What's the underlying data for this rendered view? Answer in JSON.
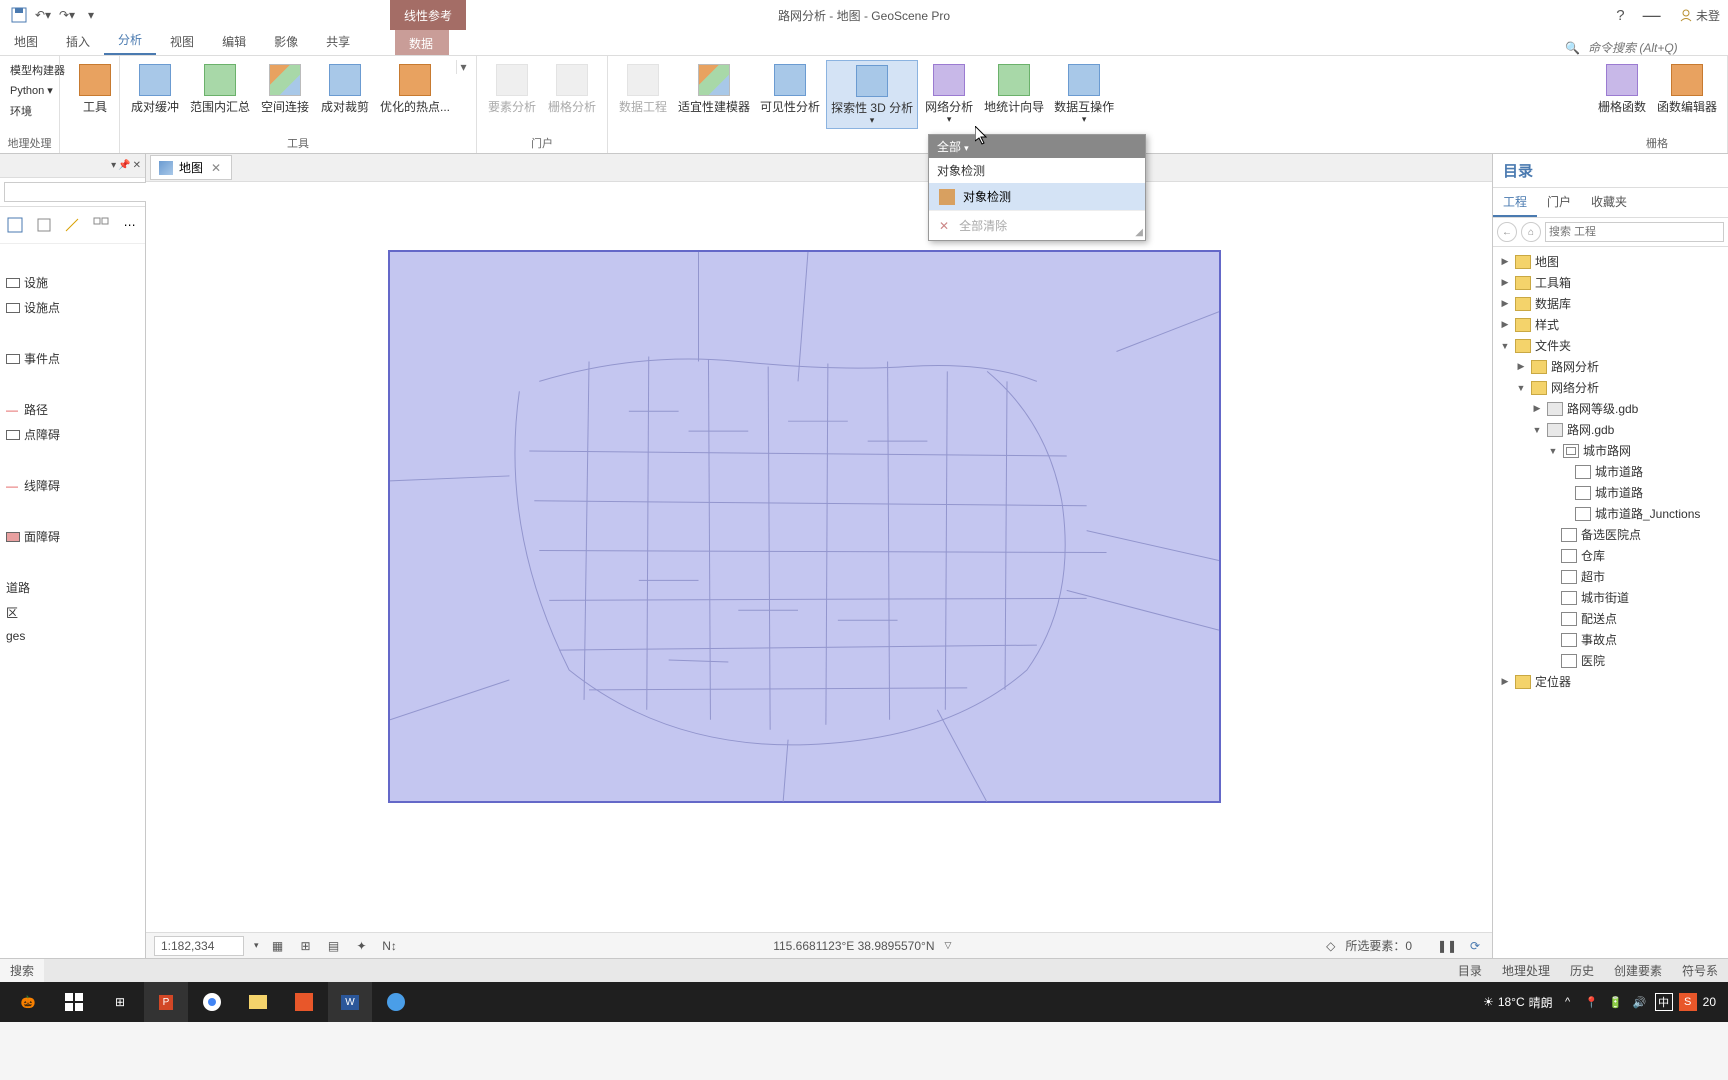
{
  "title_bar": {
    "app_title": "路网分析 - 地图 - GeoScene Pro",
    "context_title": "线性参考",
    "help_icon": "?",
    "login_status": "未登"
  },
  "main_tabs": {
    "items": [
      "地图",
      "插入",
      "分析",
      "视图",
      "编辑",
      "影像",
      "共享"
    ],
    "context_item": "数据",
    "active_index": 2,
    "search_placeholder": "命令搜索 (Alt+Q)"
  },
  "ribbon": {
    "group1": {
      "items": [
        "模型构建器",
        "Python ▾",
        "环境",
        "地理处理"
      ],
      "big_btn": "工具"
    },
    "group_geoproc_label": "工具",
    "group_portal_label": "门户",
    "group_raster_label": "栅格",
    "tools_group": [
      "成对缓冲",
      "范围内汇总",
      "空间连接",
      "成对裁剪",
      "优化的热点..."
    ],
    "portal_group": [
      "要素分析",
      "栅格分析",
      "数据工程",
      "适宜性建模器",
      "可见性分析",
      "探索性 3D 分析",
      "网络分析",
      "地统计向导",
      "数据互操作"
    ],
    "raster_group": [
      "栅格函数",
      "函数编辑器"
    ]
  },
  "dropdown": {
    "header": "全部",
    "section": "对象检测",
    "item": "对象检测",
    "clear": "全部清除"
  },
  "left_panel": {
    "items": [
      "设施",
      "设施点",
      "事件点",
      "路径",
      "点障碍",
      "线障碍",
      "面障碍",
      "道路",
      "区",
      "ges"
    ],
    "search_placeholder": ""
  },
  "map": {
    "tab_label": "地图",
    "scale": "1:182,334",
    "coords": "115.6681123°E 38.9895570°N",
    "selected": "所选要素：0"
  },
  "catalog": {
    "title": "目录",
    "tabs": [
      "工程",
      "门户",
      "收藏夹"
    ],
    "search_placeholder": "搜索 工程",
    "tree": {
      "map": "地图",
      "toolbox": "工具箱",
      "database": "数据库",
      "style": "样式",
      "folders": "文件夹",
      "f_road_analysis": "路网分析",
      "f_network": "网络分析",
      "gdb_grade": "路网等级.gdb",
      "gdb_road": "路网.gdb",
      "ds_city": "城市路网",
      "fc1": "城市道路",
      "fc2": "城市道路",
      "fc3": "城市道路_Junctions",
      "fc_hospital": "备选医院点",
      "fc_warehouse": "仓库",
      "fc_market": "超市",
      "fc_street": "城市街道",
      "fc_delivery": "配送点",
      "fc_accident": "事故点",
      "fc_hospital2": "医院",
      "locator": "定位器"
    }
  },
  "bottom_bar": {
    "left": "搜索",
    "tabs": [
      "目录",
      "地理处理",
      "历史",
      "创建要素",
      "符号系"
    ]
  },
  "taskbar": {
    "weather_temp": "18°C",
    "weather_desc": "晴朗",
    "ime1": "中",
    "ime2": "S",
    "time": "20"
  }
}
